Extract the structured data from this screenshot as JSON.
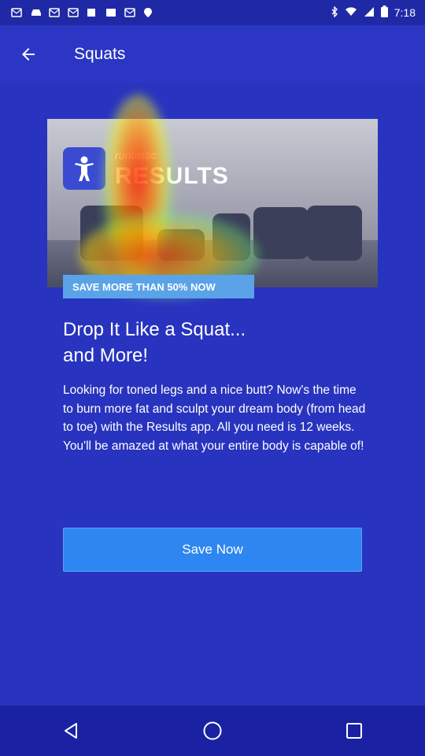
{
  "status_bar": {
    "time": "7:18",
    "left_icons": [
      "mail-icon",
      "car-icon",
      "mail-icon",
      "mail-icon",
      "square-icon",
      "email-icon",
      "mail-icon",
      "location-icon"
    ],
    "right_icons": [
      "bluetooth-icon",
      "wifi-icon",
      "signal-icon",
      "battery-icon"
    ]
  },
  "app_bar": {
    "title": "Squats",
    "back_icon": "arrow-back-icon"
  },
  "banner": {
    "brand_small": "runtastic",
    "brand_big": "RESULTS",
    "logo_icon": "person-icon"
  },
  "promo_tag": "SAVE MORE THAN 50% NOW",
  "headline": {
    "line1": "Drop It Like a Squat...",
    "line2": "and More!"
  },
  "body_text": "Looking for toned legs and a nice butt? Now's the time to burn more fat and sculpt your dream body (from head to toe) with the Results app. All you need is 12 weeks. You'll be amazed at what your entire body is capable of!",
  "cta_label": "Save Now",
  "nav_bar": {
    "back_icon": "nav-back-icon",
    "home_icon": "nav-home-icon",
    "recents_icon": "nav-recents-icon"
  },
  "colors": {
    "background": "#2833bf",
    "cta": "#2e86f0",
    "promo": "#5aa3e8"
  }
}
